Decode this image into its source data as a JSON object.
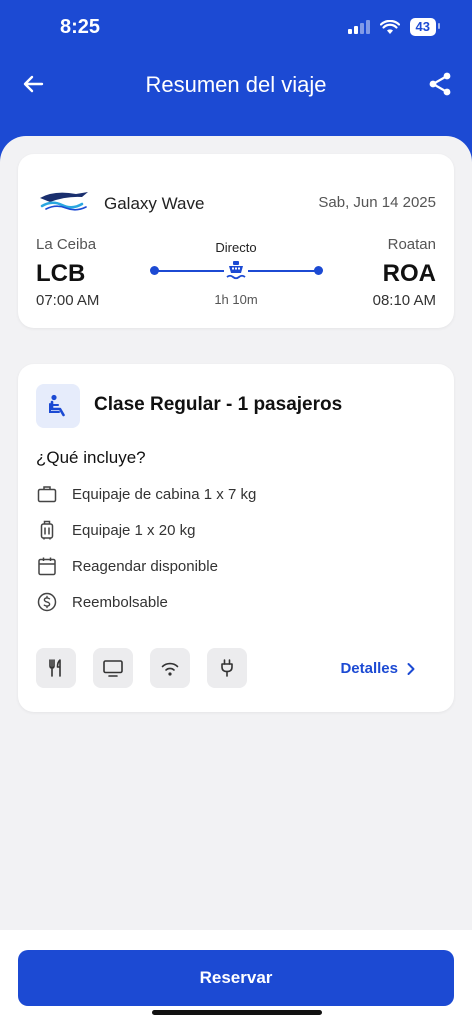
{
  "status_bar": {
    "time": "8:25",
    "battery": "43"
  },
  "nav": {
    "title": "Resumen del viaje"
  },
  "flight": {
    "carrier": "Galaxy Wave",
    "date": "Sab, Jun 14 2025",
    "origin": {
      "city": "La Ceiba",
      "code": "LCB",
      "time": "07:00 AM"
    },
    "destination": {
      "city": "Roatan",
      "code": "ROA",
      "time": "08:10 AM"
    },
    "route_type": "Directo",
    "duration": "1h 10m"
  },
  "fare": {
    "title": "Clase Regular - 1 pasajeros",
    "includes_title": "¿Qué incluye?",
    "includes": [
      {
        "icon": "briefcase-icon",
        "label": "Equipaje de cabina 1 x 7 kg"
      },
      {
        "icon": "luggage-icon",
        "label": "Equipaje 1 x 20 kg"
      },
      {
        "icon": "calendar-icon",
        "label": "Reagendar disponible"
      },
      {
        "icon": "dollar-circle-icon",
        "label": "Reembolsable"
      }
    ],
    "amenities": [
      "utensils-icon",
      "tv-icon",
      "wifi-icon",
      "plug-icon"
    ],
    "details_label": "Detalles"
  },
  "footer": {
    "reserve_label": "Reservar"
  },
  "colors": {
    "primary": "#1c4ad3",
    "background": "#f2f2f4"
  }
}
